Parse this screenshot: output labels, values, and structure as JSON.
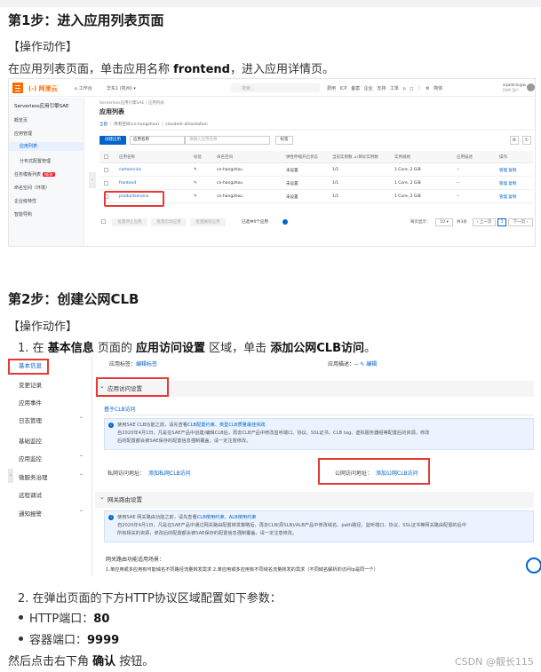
{
  "step1": {
    "title": "第1步：进入应用列表页面",
    "action_label": "【操作动作】",
    "instruction_pre": "在应用列表页面，单击应用名称 ",
    "instruction_bold": "frontend",
    "instruction_post": "，进入应用详情页。"
  },
  "shot1": {
    "topbar": {
      "logo": "(-) 阿里云",
      "workspace": "⌂ 工作台",
      "region": "华东1 (杭州) ▾",
      "search_placeholder": "搜索...",
      "links": "费用 ICP 备案 企业 支持 工单 ⌂ ◻ ♡ ⚙ 简体",
      "user_line1": "aiyadmin@w...",
      "user_line2": "RAM 用户"
    },
    "sidebar": {
      "title": "Serverless应用引擎SAE",
      "items": [
        "概览页",
        "应用管理",
        "应用列表",
        "分布式配置管理",
        "任务模板列表",
        "命名空间（环境）",
        "企业级特性",
        "智能导购"
      ],
      "new_badge": "NEW",
      "collapse": "‹"
    },
    "breadcrumb": "Serverless应用引擎SAE  /  应用列表",
    "page_title": "应用列表",
    "scope": {
      "all": "全部",
      "rest": " ｜ 所有空间(cn-hangzhou) ｜ cloudedr-atlasstation"
    },
    "toolbar": {
      "create": "创建应用",
      "select": "应用名称",
      "search_placeholder": "请输入应用名称",
      "tag": "标签",
      "settings_icon": "⚙",
      "refresh_icon": "↻"
    },
    "columns": [
      "应用名称",
      "标签",
      "命名空间",
      "弹性伸缩开启状态",
      "当前实例数 ⊿/目标实例数",
      "实例规格",
      "应用描述",
      "操作"
    ],
    "rows": [
      {
        "name": "cartservice",
        "tag": "✎",
        "ns": "cn-hangzhou",
        "elastic": "未设置",
        "inst": "1/1",
        "spec": "1 Core, 2 GiB",
        "desc": "--",
        "ops": "管理  复制"
      },
      {
        "name": "frontend",
        "tag": "✎",
        "ns": "cn-hangzhou",
        "elastic": "未设置",
        "inst": "1/1",
        "spec": "1 Core, 2 GiB",
        "desc": "--",
        "ops": "管理  复制"
      },
      {
        "name": "productservice",
        "tag": "✎",
        "ns": "cn-hangzhou",
        "elastic": "未设置",
        "inst": "1/1",
        "spec": "1 Core, 2 GiB",
        "desc": "--",
        "ops": "管理  复制"
      }
    ],
    "bottom": {
      "btn1": "批量停止应用",
      "btn2": "批量启动应用",
      "btn3": "批量删除应用",
      "selected": "已选中0个应用",
      "per_page": "每页显示：",
      "per_page_value": "10 ▾",
      "total": "共3条",
      "prev": "‹ 上一页",
      "page": "1",
      "next": "下一页 ›"
    }
  },
  "step2": {
    "title": "第2步：创建公网CLB",
    "action_label": "【操作动作】",
    "item1_num": "1.",
    "item1_pre": "在 ",
    "item1_b1": "基本信息",
    "item1_mid1": " 页面的 ",
    "item1_b2": "应用访问设置",
    "item1_mid2": " 区域，单击 ",
    "item1_b3": "添加公网CLB访问",
    "item1_post": "。",
    "item2": "2. 在弹出页面的下方HTTP协议区域配置如下参数：",
    "bullet1_label": "HTTP端口：",
    "bullet1_value": "80",
    "bullet2_label": "容器端口：",
    "bullet2_value": "9999",
    "final_pre": "然后点击右下角 ",
    "final_bold": "确认",
    "final_post": " 按钮。"
  },
  "shot2": {
    "sidebar": [
      {
        "label": "基本信息",
        "chev": ""
      },
      {
        "label": "变更记录",
        "chev": ""
      },
      {
        "label": "应用事件",
        "chev": ""
      },
      {
        "label": "日志管理",
        "chev": "⌄"
      },
      {
        "label": "基础监控",
        "chev": ""
      },
      {
        "label": "应用监控",
        "chev": "⌄"
      },
      {
        "label": "微服务治理",
        "chev": "⌄"
      },
      {
        "label": "远程调试",
        "chev": ""
      },
      {
        "label": "通知报警",
        "chev": "⌄"
      }
    ],
    "arrow": "›",
    "tag_label": "应用标签：",
    "tag_link": "编辑标签",
    "desc_label": "应用描述：--",
    "desc_link": "✎ 编辑",
    "section1": "应用访问设置",
    "tab": "基于CLB访问",
    "notice1_line1_pre": "使用SAE CLB功能之前，请先查看",
    "notice1_line1_link": "CLB配置约束、类型CLB质量最佳实践",
    "notice1_line2": "自2020年4月1日，凡是在SAE产品中创建/编辑CLB后，再去CLB产品中修改监听端口、协议、SSL证书、CLB tag、虚拟服务器组等配置后的资源，修改",
    "notice1_line3": "后的配置都会被SAE保存的配置信息强制覆盖，请一定注意修改。",
    "private_label": "私网访问地址：",
    "private_link": "添加私网CLB访问",
    "public_label": "公网访问地址：",
    "public_link": "添加公网CLB访问",
    "section2": "网关路由设置",
    "notice2_line1_pre": "使用SAE 网关路由功能之前，请先查看",
    "notice2_line1_link": "CLB使用约束、ALB使用约束",
    "notice2_line2": "自2020年4月1日，凡是在SAE产品中通过网关路由配置转发策略后，再去CLB(原SLB)/ALB产品中修改域名、path路径、监听端口、协议、SSL证书等网关路由配置的后中",
    "notice2_line3": "所有相关的资源，修改后的配置都会被SAE保存的配置信息强制覆盖，请一定注意修改。",
    "scenario_title": "网关路由功能适用场景：",
    "scenario_text": "1.单应用或多应用有可能域名不同路径流量转发需求 2.单应用或多应用有不同域名流量转发的需求（不同域名解析的访问ip是同一个）"
  },
  "watermark": "CSDN @靓长115"
}
